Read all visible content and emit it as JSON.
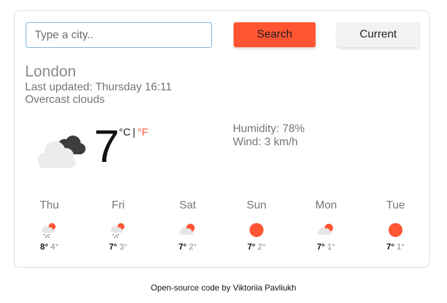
{
  "search": {
    "placeholder": "Type a city..",
    "value": ""
  },
  "buttons": {
    "search_label": "Search",
    "current_label": "Current"
  },
  "current": {
    "city": "London",
    "updated": "Last updated: Thursday 16:11",
    "description": "Overcast clouds",
    "icon": "broken-clouds-icon",
    "temperature": "7",
    "unit_c": "°C",
    "unit_separator": "|",
    "unit_f": "°F",
    "humidity": "Humidity: 78%",
    "wind": "Wind: 3 km/h"
  },
  "forecast": [
    {
      "day": "Thu",
      "max": "8°",
      "min": "4°",
      "icon": "rain-icon"
    },
    {
      "day": "Fri",
      "max": "7°",
      "min": "3°",
      "icon": "rain-icon"
    },
    {
      "day": "Sat",
      "max": "7°",
      "min": "2°",
      "icon": "partly-cloudy-icon"
    },
    {
      "day": "Sun",
      "max": "7°",
      "min": "2°",
      "icon": "sun-icon"
    },
    {
      "day": "Mon",
      "max": "7°",
      "min": "1°",
      "icon": "partly-cloudy-icon"
    },
    {
      "day": "Tue",
      "max": "7°",
      "min": "1°",
      "icon": "sun-icon"
    }
  ],
  "footer": {
    "text": "Open-source code by Viktoriia Pavliukh"
  },
  "colors": {
    "accent": "#ff5533",
    "muted_text": "#757575",
    "input_border": "#7ab2e0"
  }
}
